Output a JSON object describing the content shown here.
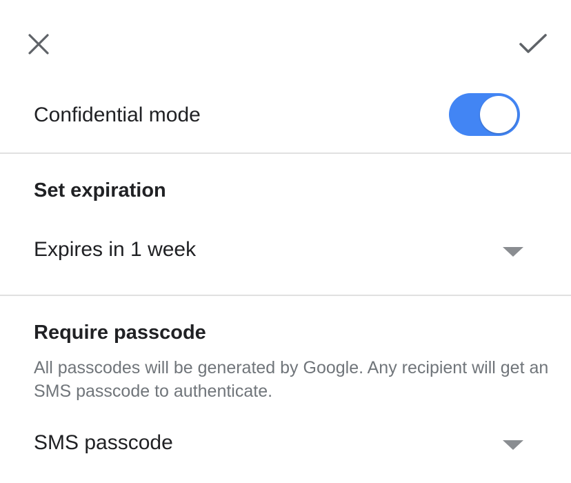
{
  "header": {
    "close_icon": "close-icon",
    "confirm_icon": "checkmark-icon"
  },
  "confidential": {
    "label": "Confidential mode",
    "enabled": true,
    "toggle_color": "#4285f4"
  },
  "expiration": {
    "title": "Set expiration",
    "selected": "Expires in 1 week",
    "icon": "dropdown-arrow-icon"
  },
  "passcode": {
    "title": "Require passcode",
    "description": "All passcodes will be generated by Google. Any recipient will get an SMS passcode to authenticate.",
    "selected": "SMS passcode",
    "icon": "dropdown-arrow-icon"
  }
}
